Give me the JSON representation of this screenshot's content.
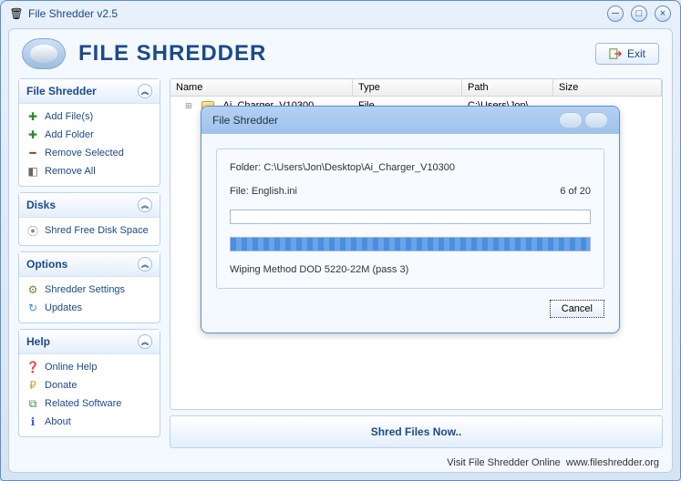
{
  "window": {
    "title": "File Shredder v2.5"
  },
  "brand": "FILE SHREDDER",
  "exit": "Exit",
  "sidebar": {
    "panels": [
      {
        "title": "File Shredder",
        "items": [
          {
            "label": "Add File(s)",
            "icon": "plus",
            "color": "#2a8a2a"
          },
          {
            "label": "Add Folder",
            "icon": "plus",
            "color": "#2a8a2a"
          },
          {
            "label": "Remove Selected",
            "icon": "minus",
            "color": "#a03a3a"
          },
          {
            "label": "Remove All",
            "icon": "eraser",
            "color": "#666"
          }
        ]
      },
      {
        "title": "Disks",
        "items": [
          {
            "label": "Shred Free Disk Space",
            "icon": "disk",
            "color": "#888"
          }
        ]
      },
      {
        "title": "Options",
        "items": [
          {
            "label": "Shredder Settings",
            "icon": "gear",
            "color": "#6a8a3a"
          },
          {
            "label": "Updates",
            "icon": "updates",
            "color": "#3a8ad0"
          }
        ]
      },
      {
        "title": "Help",
        "items": [
          {
            "label": "Online Help",
            "icon": "help",
            "color": "#3a5ad0"
          },
          {
            "label": "Donate",
            "icon": "donate",
            "color": "#caa23a"
          },
          {
            "label": "Related Software",
            "icon": "related",
            "color": "#3a8a5a"
          },
          {
            "label": "About",
            "icon": "about",
            "color": "#3a5ad0"
          }
        ]
      }
    ]
  },
  "list": {
    "headers": [
      "Name",
      "Type",
      "Path",
      "Size"
    ],
    "rows": [
      {
        "name": "Ai_Charger_V10300",
        "type": "File",
        "path": "C:\\Users\\Jon\\",
        "size": ""
      }
    ]
  },
  "dialog": {
    "title": "File Shredder",
    "folder_label": "Folder:",
    "folder": "C:\\Users\\Jon\\Desktop\\Ai_Charger_V10300",
    "file_label": "File:",
    "file": "English.ini",
    "count": "6  of  20",
    "method": "Wiping Method DOD 5220-22M  (pass 3)",
    "cancel": "Cancel"
  },
  "shred_now": "Shred Files Now..",
  "footer": {
    "text": "Visit File Shredder Online",
    "url": "www.fileshredder.org"
  }
}
